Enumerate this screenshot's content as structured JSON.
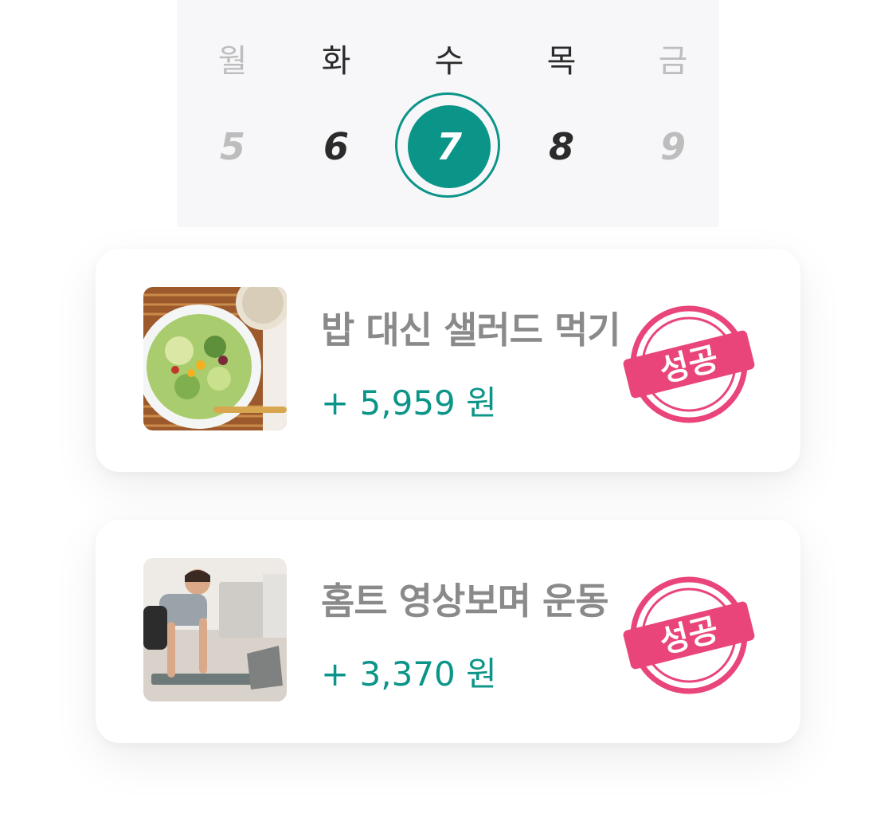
{
  "calendar": {
    "days": [
      {
        "weekday": "월",
        "date": "5",
        "state": "muted"
      },
      {
        "weekday": "화",
        "date": "6",
        "state": "normal"
      },
      {
        "weekday": "수",
        "date": "7",
        "state": "selected"
      },
      {
        "weekday": "목",
        "date": "8",
        "state": "normal"
      },
      {
        "weekday": "금",
        "date": "9",
        "state": "muted"
      }
    ],
    "accent_color": "#0b9488"
  },
  "tasks": [
    {
      "title": "밥 대신 샐러드 먹기",
      "reward": "+ 5,959 원",
      "badge": "성공",
      "image": "salad-photo"
    },
    {
      "title": "홈트 영상보며 운동",
      "reward": "+ 3,370 원",
      "badge": "성공",
      "image": "workout-photo"
    }
  ],
  "colors": {
    "stamp": "#e9457a",
    "reward": "#0b9488",
    "title": "#8a8a8a"
  }
}
